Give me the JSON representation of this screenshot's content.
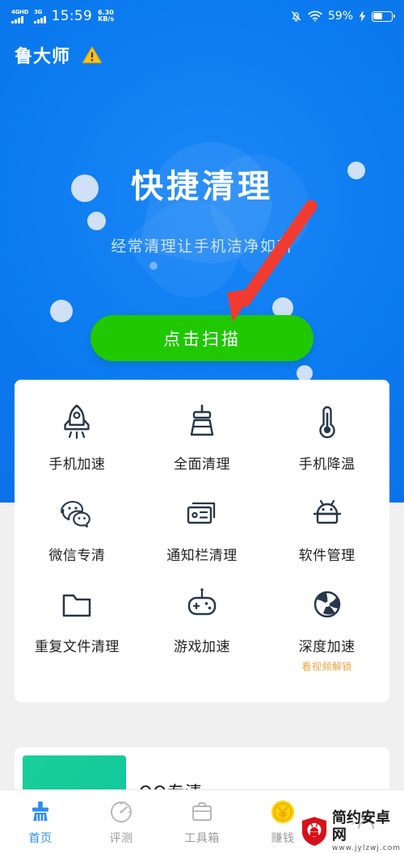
{
  "statusbar": {
    "network_primary": "4GHD",
    "network_secondary": "3G",
    "time": "15:59",
    "speed_value": "6.30",
    "speed_unit": "KB/s",
    "battery_percent": "59%",
    "icons": [
      "bell-muted-icon",
      "wifi-icon",
      "charging-bolt-icon",
      "battery-icon"
    ]
  },
  "header": {
    "app_title": "鲁大师",
    "warning_icon": "warning-triangle-icon"
  },
  "hero": {
    "title": "快捷清理",
    "subtitle": "经常清理让手机洁净如新",
    "scan_button": "点击扫描",
    "bg_color": "#0b7bf0",
    "button_color": "#1fc800"
  },
  "annotation": {
    "arrow_color": "#f23b30",
    "arrow_target": "点击扫描"
  },
  "tools": [
    {
      "label": "手机加速",
      "icon": "rocket-icon",
      "tag": ""
    },
    {
      "label": "全面清理",
      "icon": "broom-icon",
      "tag": ""
    },
    {
      "label": "手机降温",
      "icon": "thermometer-icon",
      "tag": ""
    },
    {
      "label": "微信专清",
      "icon": "wechat-icon",
      "tag": ""
    },
    {
      "label": "通知栏清理",
      "icon": "notification-card-icon",
      "tag": ""
    },
    {
      "label": "软件管理",
      "icon": "android-robot-icon",
      "tag": ""
    },
    {
      "label": "重复文件清理",
      "icon": "folder-icon",
      "tag": ""
    },
    {
      "label": "游戏加速",
      "icon": "gamepad-icon",
      "tag": ""
    },
    {
      "label": "深度加速",
      "icon": "fan-turbine-icon",
      "tag": "看视频解锁"
    }
  ],
  "promo_card": {
    "title": "QQ专清",
    "thumb_color": "#16cc9b"
  },
  "bottomnav": {
    "items": [
      {
        "label": "首页",
        "icon": "broom-icon",
        "active": true
      },
      {
        "label": "评测",
        "icon": "speedometer-icon",
        "active": false
      },
      {
        "label": "工具箱",
        "icon": "briefcase-icon",
        "active": false
      },
      {
        "label": "赚钱",
        "icon": "yuan-coin-icon",
        "active": false
      },
      {
        "label": "",
        "icon": "user-profile-icon",
        "active": false
      }
    ],
    "active_color": "#2b8ef0",
    "inactive_color": "#9a9a9a"
  },
  "watermark": {
    "name": "简约安卓网",
    "url": "www.jylzwj.com",
    "icon": "android-shield-icon",
    "color": "#d5121a"
  }
}
